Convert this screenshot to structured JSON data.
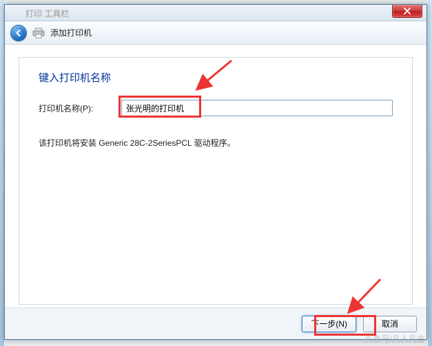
{
  "titlebar": {
    "blurred_text": "打印 工具栏"
  },
  "toolbar": {
    "title": "添加打印机"
  },
  "heading": "键入打印机名称",
  "form": {
    "name_label": "打印机名称(P):",
    "name_value": "张光明的打印机"
  },
  "note": "该打印机将安装 Generic 28C-2SeriesPCL 驱动程序。",
  "footer": {
    "next": "下一步(N)",
    "cancel": "取消"
  },
  "watermark": "头条号/凡人凡言"
}
